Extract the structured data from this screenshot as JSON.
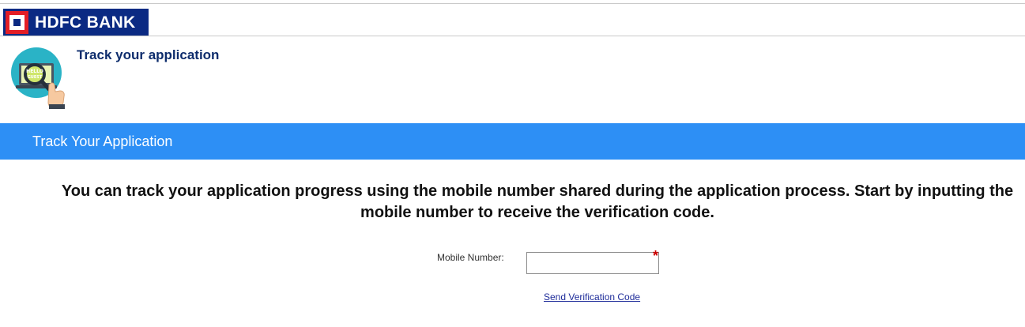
{
  "header": {
    "logo_text": "HDFC BANK"
  },
  "page": {
    "title": "Track your application",
    "illustration_text": [
      "HELLO",
      "GUEST"
    ]
  },
  "banner": {
    "title": "Track Your Application"
  },
  "instructions": {
    "text": "You can track your application progress using the mobile number shared during the application process. Start by inputting the mobile number to receive the verification code."
  },
  "form": {
    "mobile_label": "Mobile Number:",
    "mobile_value": "",
    "mobile_placeholder": "",
    "required_marker": "*",
    "send_code_label": "Send Verification Code"
  },
  "colors": {
    "brand_blue": "#0b2a83",
    "brand_red": "#e31e26",
    "banner_blue": "#2d8ff5",
    "title_navy": "#0d2c6c"
  }
}
